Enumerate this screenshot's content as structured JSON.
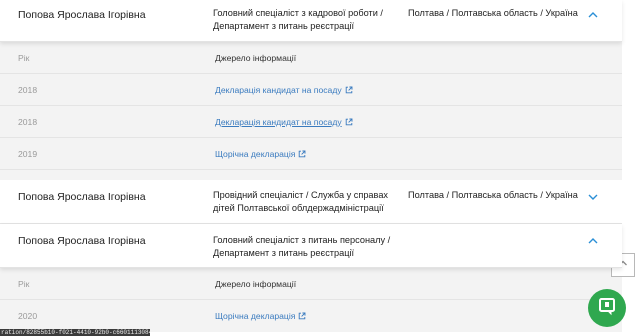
{
  "records": [
    {
      "name": "Попова Ярослава Ігорівна",
      "position": "Головний спеціаліст з кадрової роботи / Департамент з питань реєстрації",
      "location": "Полтава / Полтавська область / Україна",
      "expanded": true,
      "details": {
        "year_header": "Рік",
        "source_header": "Джерело інформації",
        "rows": [
          {
            "year": "2018",
            "source": "Декларація кандидат на посаду"
          },
          {
            "year": "2018",
            "source": "Декларація кандидат на посаду"
          },
          {
            "year": "2019",
            "source": "Щорічна декларація"
          }
        ]
      }
    },
    {
      "name": "Попова Ярослава Ігорівна",
      "position": "Провідний спеціаліст / Служба у справах дітей Полтавської облдержадміністрації",
      "location": "Полтава / Полтавська область / Україна",
      "expanded": false
    },
    {
      "name": "Попова Ярослава Ігорівна",
      "position": "Головний спеціаліст з питань персоналу / Департамент з питань реєстрації",
      "location": "",
      "expanded": true,
      "details": {
        "year_header": "Рік",
        "source_header": "Джерело інформації",
        "rows": [
          {
            "year": "2020",
            "source": "Щорічна декларація"
          }
        ]
      }
    }
  ],
  "status_bar": "ration/82855b10-f021-4410-92b0-c6601113084e",
  "colors": {
    "link": "#3a7bbf",
    "chevron": "#2a8fd6",
    "fab": "#2fa84f"
  },
  "icons": {
    "expand": "chevron-down-icon",
    "collapse": "chevron-up-icon",
    "external": "external-link-icon",
    "scroll_top": "arrow-up-icon",
    "chat": "chat-icon"
  }
}
